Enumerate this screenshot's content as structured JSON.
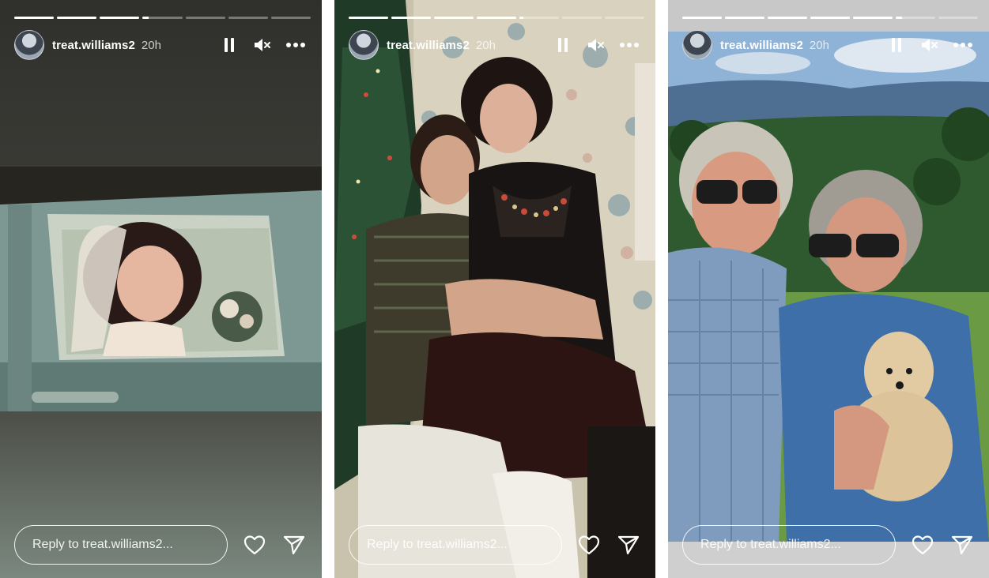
{
  "stories": [
    {
      "username": "treat.williams2",
      "time": "20h",
      "reply_placeholder": "Reply to treat.williams2...",
      "progress": [
        1,
        1,
        1,
        0.15,
        0,
        0,
        0
      ]
    },
    {
      "username": "treat.williams2",
      "time": "20h",
      "reply_placeholder": "Reply to treat.williams2...",
      "progress": [
        1,
        1,
        1,
        1,
        0.1,
        0,
        0
      ]
    },
    {
      "username": "treat.williams2",
      "time": "20h",
      "reply_placeholder": "Reply to treat.williams2...",
      "progress": [
        1,
        1,
        1,
        1,
        1,
        0.15,
        0
      ]
    }
  ],
  "icons": {
    "pause": "pause-icon",
    "mute": "muted-speaker-icon",
    "more": "more-options-icon",
    "like": "heart-icon",
    "share": "send-icon"
  }
}
